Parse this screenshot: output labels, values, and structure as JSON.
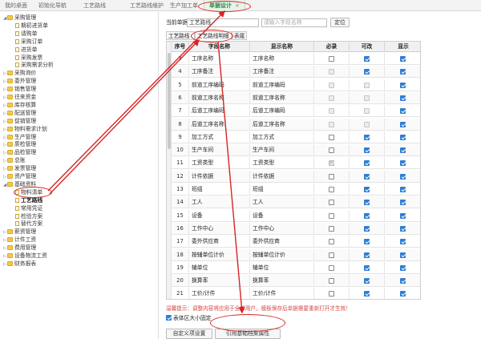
{
  "tabs": [
    {
      "label": "我的桌面",
      "active": false
    },
    {
      "label": "初始化导航",
      "active": false
    },
    {
      "label": "工艺路线",
      "active": false
    },
    {
      "label": "工艺路线维护",
      "active": false
    },
    {
      "label": "生产加工单",
      "active": false
    },
    {
      "label": "单据设计",
      "active": true,
      "close": "×"
    }
  ],
  "sidebar": {
    "items": [
      {
        "label": "采购管理",
        "level": 0,
        "open": true,
        "type": "folder"
      },
      {
        "label": "期初进货单",
        "level": 1,
        "type": "doc"
      },
      {
        "label": "请购单",
        "level": 1,
        "type": "doc"
      },
      {
        "label": "采购订单",
        "level": 1,
        "type": "doc"
      },
      {
        "label": "进货单",
        "level": 1,
        "type": "doc"
      },
      {
        "label": "采购发票",
        "level": 1,
        "type": "doc"
      },
      {
        "label": "采购需求分析",
        "level": 1,
        "type": "doc"
      },
      {
        "label": "采购询价",
        "level": 0,
        "type": "folder"
      },
      {
        "label": "委外管理",
        "level": 0,
        "type": "folder"
      },
      {
        "label": "销售管理",
        "level": 0,
        "type": "folder"
      },
      {
        "label": "往来资金",
        "level": 0,
        "type": "folder"
      },
      {
        "label": "库存核算",
        "level": 0,
        "type": "folder"
      },
      {
        "label": "配送管理",
        "level": 0,
        "type": "folder"
      },
      {
        "label": "促销管理",
        "level": 0,
        "type": "folder"
      },
      {
        "label": "物料需求计划",
        "level": 0,
        "type": "folder"
      },
      {
        "label": "生产管理",
        "level": 0,
        "type": "folder"
      },
      {
        "label": "质检管理",
        "level": 0,
        "type": "folder"
      },
      {
        "label": "品检管理",
        "level": 0,
        "type": "folder"
      },
      {
        "label": "总账",
        "level": 0,
        "type": "folder"
      },
      {
        "label": "发票管理",
        "level": 0,
        "type": "folder"
      },
      {
        "label": "资产管理",
        "level": 0,
        "type": "folder"
      },
      {
        "label": "基础资料",
        "level": 0,
        "open": true,
        "type": "folder"
      },
      {
        "label": "物料清单",
        "level": 1,
        "type": "doc"
      },
      {
        "label": "工艺路线",
        "level": 1,
        "type": "doc",
        "selected": true
      },
      {
        "label": "常用凭证",
        "level": 1,
        "type": "doc"
      },
      {
        "label": "检验方案",
        "level": 1,
        "type": "doc"
      },
      {
        "label": "替代方案",
        "level": 1,
        "type": "doc"
      },
      {
        "label": "薪资管理",
        "level": 0,
        "type": "folder"
      },
      {
        "label": "计件工资",
        "level": 0,
        "type": "folder"
      },
      {
        "label": "费用管理",
        "level": 0,
        "type": "folder"
      },
      {
        "label": "设备物流工资",
        "level": 0,
        "type": "folder"
      },
      {
        "label": "财务报表",
        "level": 0,
        "type": "folder"
      }
    ]
  },
  "form": {
    "current_doc_label": "当前单据",
    "current_doc_value": "工艺路线",
    "search_placeholder": "请输入字段名称",
    "locate_label": "定位"
  },
  "subtabs": [
    "工艺路线",
    "工艺路线明细",
    "表尾"
  ],
  "grid": {
    "headers": [
      "序号",
      "字段名称",
      "显示名称",
      "必录",
      "可改",
      "显示"
    ],
    "rows": [
      {
        "no": "3",
        "field": "工序名称",
        "display": "工序名称",
        "req": false,
        "req_dis": false,
        "edit": true,
        "edit_dis": false,
        "show": true
      },
      {
        "no": "4",
        "field": "工序备注",
        "display": "工序备注",
        "req": false,
        "req_dis": true,
        "edit": true,
        "edit_dis": false,
        "show": true
      },
      {
        "no": "5",
        "field": "前道工序编码",
        "display": "前道工序编码",
        "req": false,
        "req_dis": true,
        "edit": false,
        "edit_dis": true,
        "show": true
      },
      {
        "no": "6",
        "field": "前道工序名称",
        "display": "前道工序名称",
        "req": false,
        "req_dis": true,
        "edit": false,
        "edit_dis": true,
        "show": true
      },
      {
        "no": "7",
        "field": "后道工序编码",
        "display": "后道工序编码",
        "req": false,
        "req_dis": true,
        "edit": false,
        "edit_dis": true,
        "show": true
      },
      {
        "no": "8",
        "field": "后道工序名称",
        "display": "后道工序名称",
        "req": false,
        "req_dis": true,
        "edit": false,
        "edit_dis": true,
        "show": true
      },
      {
        "no": "9",
        "field": "加工方式",
        "display": "加工方式",
        "req": false,
        "req_dis": false,
        "edit": true,
        "edit_dis": false,
        "show": true
      },
      {
        "no": "10",
        "field": "生产车间",
        "display": "生产车间",
        "req": false,
        "req_dis": false,
        "edit": true,
        "edit_dis": false,
        "show": true
      },
      {
        "no": "11",
        "field": "工资类型",
        "display": "工资类型",
        "req": true,
        "req_dis": true,
        "edit": true,
        "edit_dis": false,
        "show": true
      },
      {
        "no": "12",
        "field": "计件依据",
        "display": "计件依据",
        "req": false,
        "req_dis": false,
        "edit": true,
        "edit_dis": false,
        "show": true
      },
      {
        "no": "13",
        "field": "班组",
        "display": "班组",
        "req": false,
        "req_dis": false,
        "edit": true,
        "edit_dis": false,
        "show": true
      },
      {
        "no": "14",
        "field": "工人",
        "display": "工人",
        "req": false,
        "req_dis": false,
        "edit": true,
        "edit_dis": false,
        "show": true
      },
      {
        "no": "15",
        "field": "设备",
        "display": "设备",
        "req": false,
        "req_dis": false,
        "edit": true,
        "edit_dis": false,
        "show": true
      },
      {
        "no": "16",
        "field": "工作中心",
        "display": "工作中心",
        "req": false,
        "req_dis": false,
        "edit": true,
        "edit_dis": false,
        "show": true
      },
      {
        "no": "17",
        "field": "委外供应商",
        "display": "委外供应商",
        "req": false,
        "req_dis": false,
        "edit": true,
        "edit_dis": false,
        "show": true
      },
      {
        "no": "18",
        "field": "按辅单位计价",
        "display": "按辅单位计价",
        "req": false,
        "req_dis": false,
        "edit": true,
        "edit_dis": false,
        "show": true
      },
      {
        "no": "19",
        "field": "辅单位",
        "display": "辅单位",
        "req": false,
        "req_dis": false,
        "edit": true,
        "edit_dis": false,
        "show": true
      },
      {
        "no": "20",
        "field": "换算率",
        "display": "换算率",
        "req": false,
        "req_dis": false,
        "edit": true,
        "edit_dis": false,
        "show": true
      },
      {
        "no": "21",
        "field": "工价/计件",
        "display": "工价/计件",
        "req": false,
        "req_dis": false,
        "edit": true,
        "edit_dis": false,
        "show": true
      }
    ]
  },
  "footer": {
    "hint": "温馨提示：调整内容将应用于全部用户。模板保存后单据需要重新打开才生效！",
    "checkbox_label": "表体区大小固定",
    "checkbox_checked": true,
    "btn_custom": "自定义项设置",
    "btn_reference": "引用基础档案属性"
  },
  "colors": {
    "accent": "#2d8a47",
    "annotation": "#d62424",
    "hint": "#d64545",
    "checkbox": "#2f7dd3"
  }
}
